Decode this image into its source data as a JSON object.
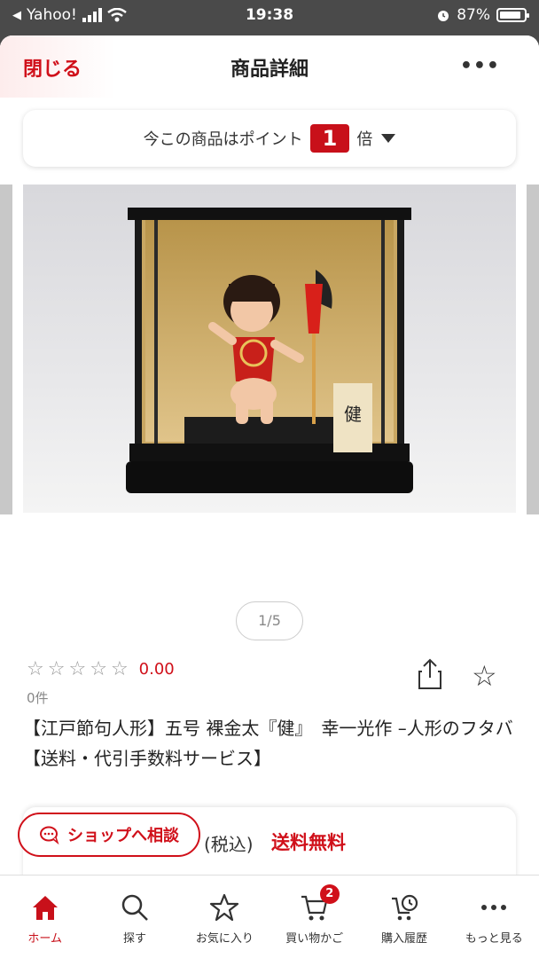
{
  "status_bar": {
    "carrier": "Yahoo!",
    "time": "19:38",
    "battery": "87%",
    "battery_level": 0.87
  },
  "header": {
    "close_label": "閉じる",
    "title": "商品詳細",
    "more_label": "•••"
  },
  "points": {
    "prefix": "今この商品はポイント",
    "multiplier": "1",
    "suffix": "倍"
  },
  "gallery": {
    "pager": "1/5",
    "photo_icon": "kintaro-doll-case-photo"
  },
  "rating": {
    "score": "0.00",
    "count": "0件",
    "stars": 0
  },
  "product": {
    "title": "【江戸節句人形】五号 裸金太『健』　幸一光作 –人形のフタバ【送料・代引手数料サービス】"
  },
  "price": {
    "tax": "(税込)",
    "shipping": "送料無料"
  },
  "consult": {
    "label": "ショップへ相談"
  },
  "tabs": [
    {
      "label": "ホーム",
      "icon": "home-icon"
    },
    {
      "label": "探す",
      "icon": "search-icon"
    },
    {
      "label": "お気に入り",
      "icon": "star-icon"
    },
    {
      "label": "買い物かご",
      "icon": "cart-icon",
      "badge": "2"
    },
    {
      "label": "購入履歴",
      "icon": "history-icon"
    },
    {
      "label": "もっと見る",
      "icon": "more-icon"
    }
  ],
  "colors": {
    "accent": "#d0101a",
    "point_badge": "#c8101a"
  }
}
